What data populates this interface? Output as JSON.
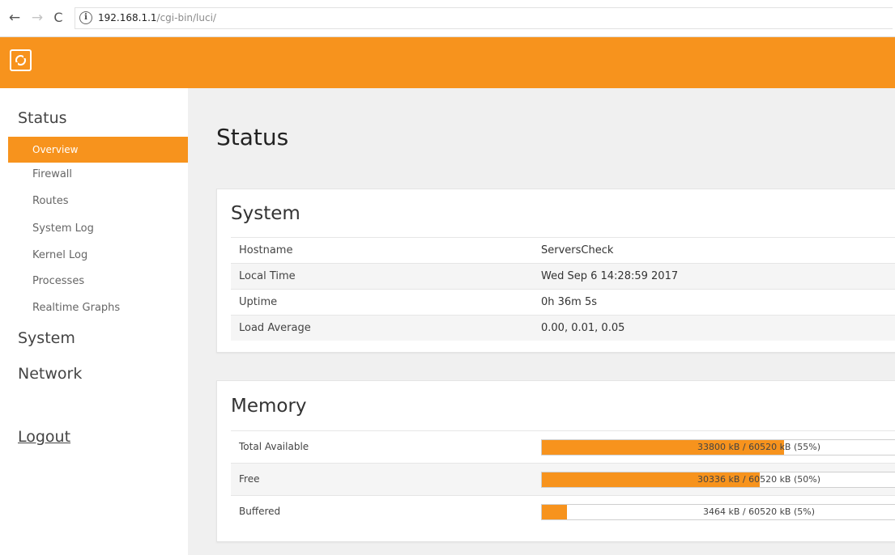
{
  "browser": {
    "back_icon": "←",
    "forward_icon": "→",
    "reload_icon": "C",
    "info_icon": "i",
    "url_host": "192.168.1.1",
    "url_path": "/cgi-bin/luci/"
  },
  "colors": {
    "accent": "#f7931d",
    "sidebar_bg": "#ffffff",
    "page_bg": "#f0f0f0"
  },
  "sidebar": {
    "status_label": "Status",
    "items": [
      "Overview",
      "Firewall",
      "Routes",
      "System Log",
      "Kernel Log",
      "Processes",
      "Realtime Graphs"
    ],
    "system_label": "System",
    "network_label": "Network",
    "logout_label": "Logout"
  },
  "main": {
    "page_title": "Status",
    "system": {
      "title": "System",
      "rows": [
        {
          "label": "Hostname",
          "value": "ServersCheck"
        },
        {
          "label": "Local Time",
          "value": "Wed Sep 6 14:28:59 2017"
        },
        {
          "label": "Uptime",
          "value": "0h 36m 5s"
        },
        {
          "label": "Load Average",
          "value": "0.00, 0.01, 0.05"
        }
      ]
    },
    "memory": {
      "title": "Memory",
      "rows": [
        {
          "label": "Total Available",
          "text": "33800 kB / 60520 kB (55%)",
          "fraction": 0.558
        },
        {
          "label": "Free",
          "text": "30336 kB / 60520 kB (50%)",
          "fraction": 0.501
        },
        {
          "label": "Buffered",
          "text": "3464 kB / 60520 kB (5%)",
          "fraction": 0.057
        }
      ]
    }
  }
}
